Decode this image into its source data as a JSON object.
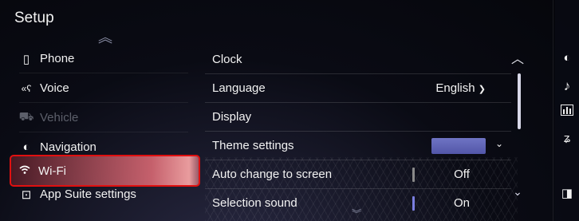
{
  "header": {
    "title": "Setup"
  },
  "sidebar": {
    "items": [
      {
        "label": "Phone",
        "icon": "phone-icon",
        "glyph": "▯"
      },
      {
        "label": "Voice",
        "icon": "voice-icon",
        "glyph": "«ʕ"
      },
      {
        "label": "Vehicle",
        "icon": "vehicle-icon",
        "glyph": "⛟",
        "disabled": true
      },
      {
        "label": "Navigation",
        "icon": "navigation-icon",
        "glyph": "◐"
      },
      {
        "label": "Wi-Fi",
        "icon": "wifi-icon",
        "glyph": "ᯤ",
        "selected": true
      },
      {
        "label": "App Suite settings",
        "icon": "app-suite-icon",
        "glyph": "⊡"
      }
    ]
  },
  "main": {
    "rows": [
      {
        "label": "Clock"
      },
      {
        "label": "Language",
        "value": "English"
      },
      {
        "label": "Display"
      },
      {
        "label": "Theme settings",
        "swatch_color": "#5e63b8"
      },
      {
        "label": "Auto change to screen",
        "value": "Off"
      },
      {
        "label": "Selection sound",
        "value": "On"
      }
    ]
  },
  "right_rail": {
    "icons": [
      "navigation-icon",
      "music-icon",
      "equalizer-icon",
      "voice-command-icon",
      "screen-toggle-icon"
    ]
  },
  "colors": {
    "selection_border": "#e01010",
    "toggle_on": "#7b7fe0",
    "toggle_off": "#8a8a8a"
  }
}
